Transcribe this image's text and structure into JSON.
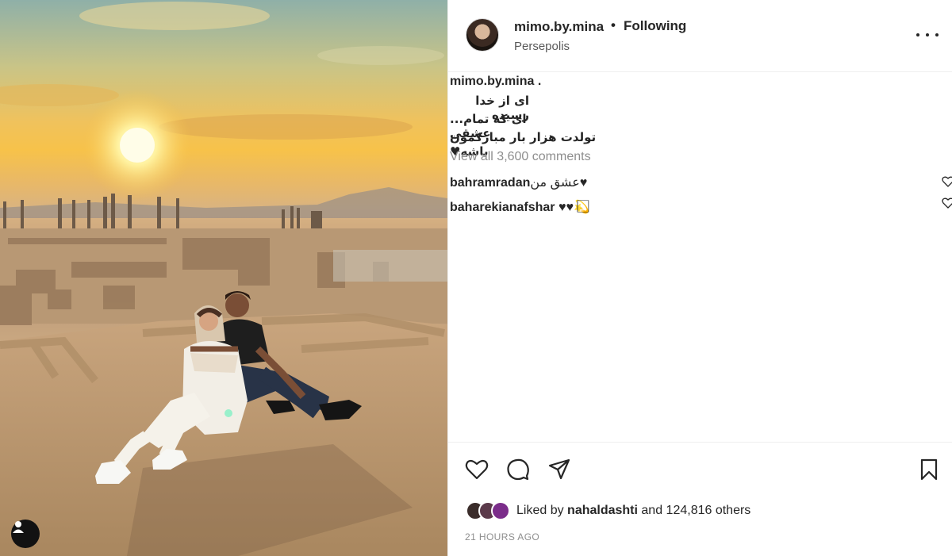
{
  "post": {
    "username": "mimo.by.mina",
    "dot": "•",
    "follow_status": "Following",
    "location": "Persepolis"
  },
  "caption": {
    "username": "mimo.by.mina .",
    "lines": [
      "ای از خدا رسیده",
      "...ای که تمام عشقی",
      "تولدت هزار بار مبارکمون باشه♥"
    ]
  },
  "view_all_comments": "View all 3,600 comments",
  "comments": [
    {
      "username": "bahramradan",
      "text": "عشق من♥"
    },
    {
      "username": "baharekianafshar",
      "text": "♥♥💫⃞⃞⃞"
    }
  ],
  "likes": {
    "prefix": "Liked by",
    "user": "nahaldashti",
    "suffix": "and 124,816 others"
  },
  "timestamp": "21 HOURS AGO",
  "icons": {
    "photo": "user-tag-icon",
    "header": "more-options-icon",
    "actions": [
      "heart-icon",
      "comment-icon",
      "share-icon",
      "bookmark-icon"
    ]
  },
  "colors": {
    "text": "#262626",
    "secondary": "#8e8e8e",
    "divider": "#efefef"
  }
}
